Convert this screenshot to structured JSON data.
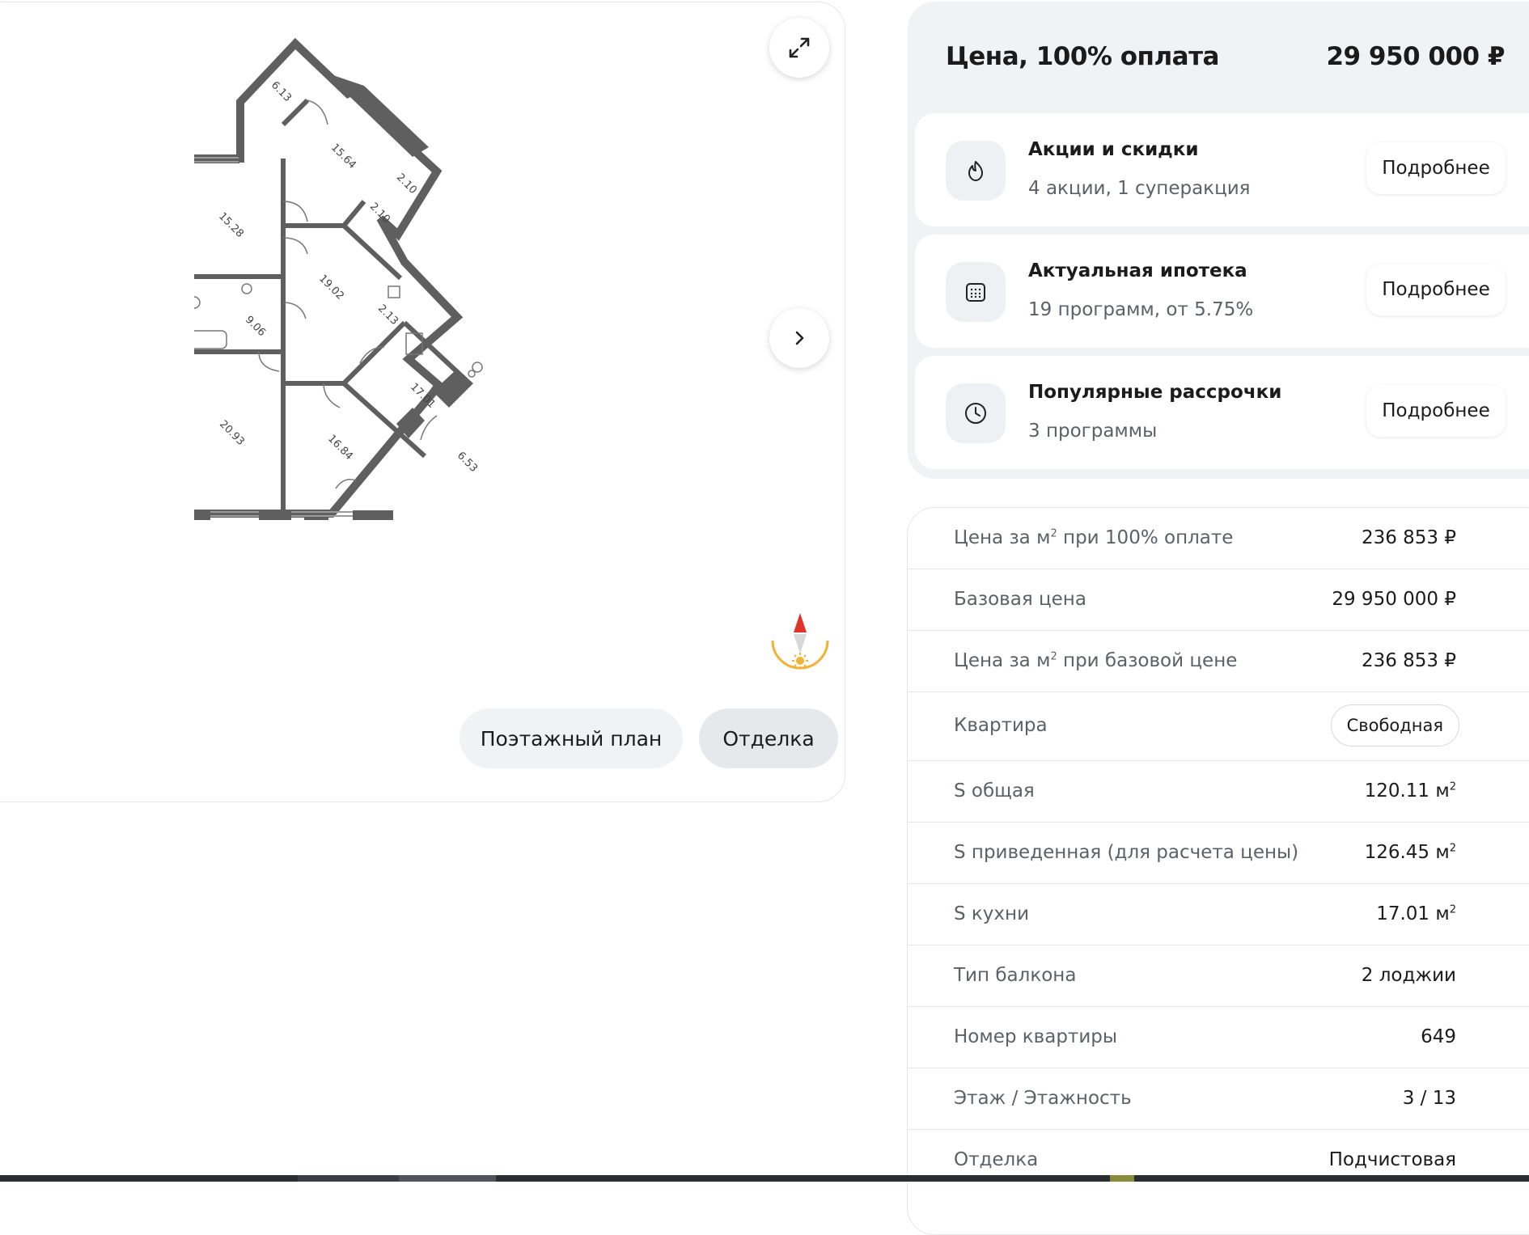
{
  "plan": {
    "rooms": [
      "6.13",
      "15.64",
      "2.10",
      "2.10",
      "15.28",
      "19.02",
      "9.06",
      "2.13",
      "17.01",
      "20.93",
      "16.84",
      "6.53"
    ],
    "floor_plan_label": "Поэтажный план",
    "finish_label": "Отделка",
    "icons": {
      "expand": "expand-arrows-icon",
      "next": "chevron-right-icon",
      "compass": "compass-sun-icon"
    }
  },
  "price": {
    "title": "Цена, 100% оплата",
    "value": "29 950 000 ₽"
  },
  "offers": [
    {
      "title": "Акции и скидки",
      "subtitle": "4 акции, 1 суперакция",
      "more": "Подробнее",
      "icon": "flame-icon"
    },
    {
      "title": "Актуальная ипотека",
      "subtitle": "19 программ, от 5.75%",
      "more": "Подробнее",
      "icon": "calendar-icon"
    },
    {
      "title": "Популярные рассрочки",
      "subtitle": "3 программы",
      "more": "Подробнее",
      "icon": "clock-icon"
    }
  ],
  "specs": {
    "price_m2_full": {
      "label_a": "Цена за м",
      "sup": "2",
      "label_b": " при 100% оплате",
      "value": "236 853 ₽"
    },
    "base_price": {
      "label": "Базовая цена",
      "value": "29 950 000 ₽"
    },
    "price_m2_base": {
      "label_a": "Цена за м",
      "sup": "2",
      "label_b": " при базовой цене",
      "value": "236 853 ₽"
    },
    "apartment": {
      "label": "Квартира",
      "value": "Свободная"
    },
    "area_total": {
      "label": "S общая",
      "value": "120.11 м",
      "sup": "2"
    },
    "area_reduced": {
      "label": "S приведенная (для расчета цены)",
      "value": "126.45 м",
      "sup": "2"
    },
    "area_kitchen": {
      "label": "S кухни",
      "value": "17.01 м",
      "sup": "2"
    },
    "balcony": {
      "label": "Тип балкона",
      "value": "2 лоджии"
    },
    "number": {
      "label": "Номер квартиры",
      "value": "649"
    },
    "floor": {
      "label": "Этаж / Этажность",
      "value": "3 / 13"
    },
    "finish": {
      "label": "Отделка",
      "value": "Подчистовая"
    }
  },
  "colors": {
    "accent_red": "#e0342b",
    "sun_yellow": "#f2b233",
    "wall": "#5f5f5f",
    "panel_bg": "#f1f2f4"
  }
}
